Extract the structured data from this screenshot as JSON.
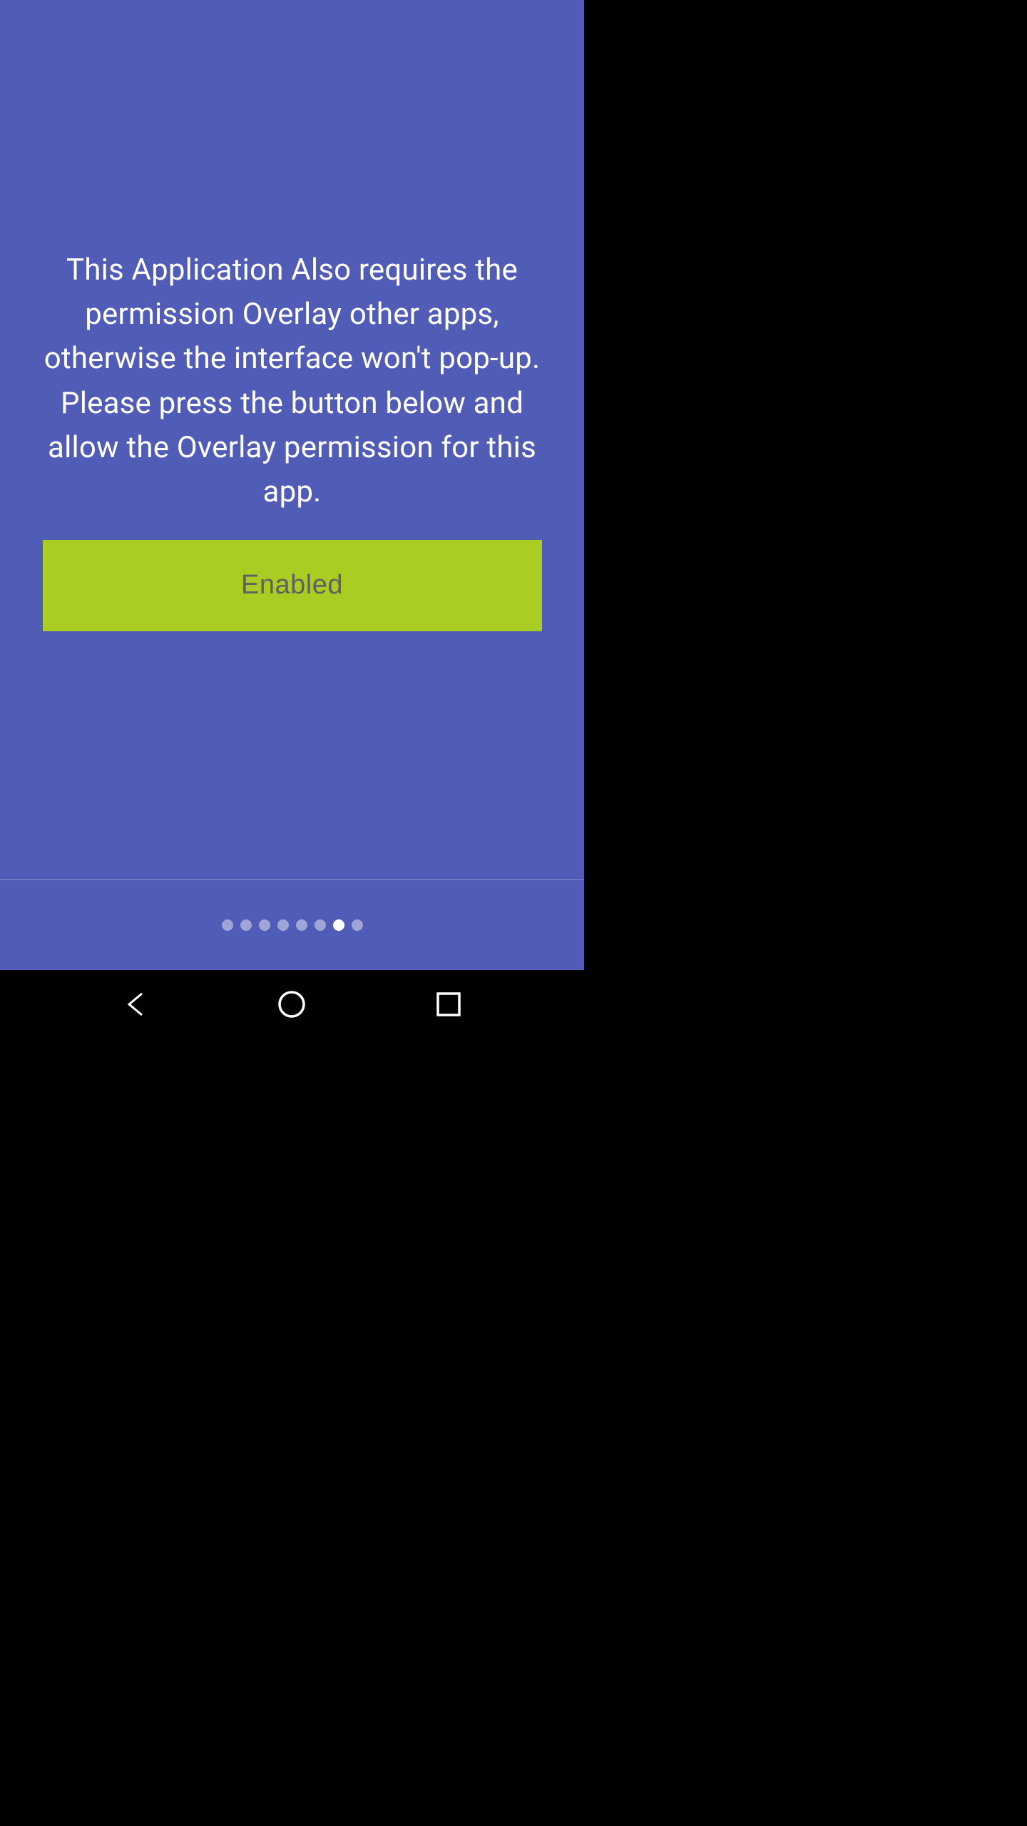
{
  "content": {
    "message": "This Application Also requires the permission Overlay other apps, otherwise the interface won't pop-up. Please press the button below and allow the Overlay permission for this app.",
    "button_label": "Enabled"
  },
  "pager": {
    "total": 8,
    "active_index": 6
  }
}
